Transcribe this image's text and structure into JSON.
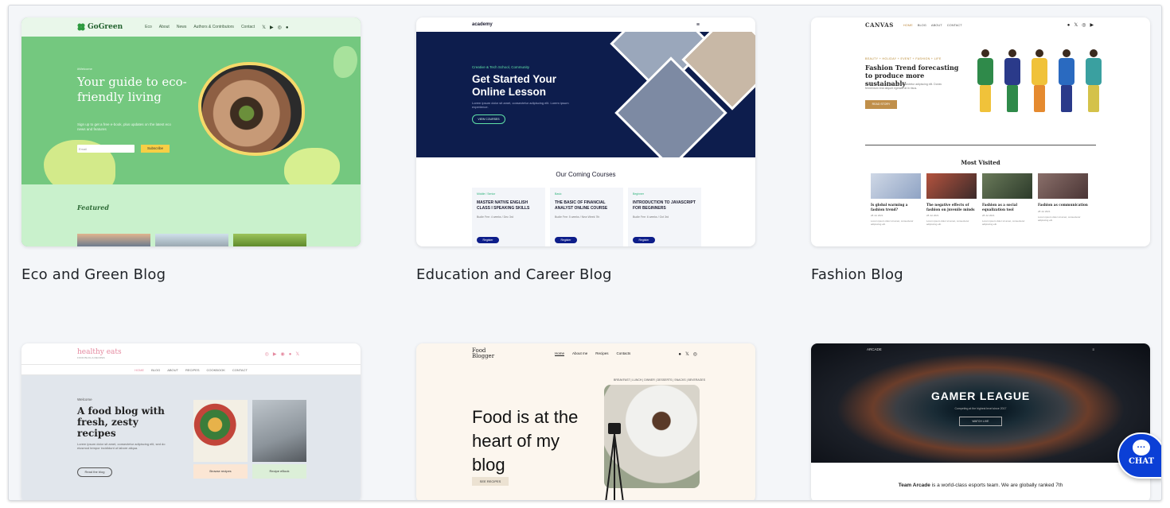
{
  "cards": {
    "eco": {
      "title": "Eco and Green Blog",
      "logo": "GoGreen",
      "nav": [
        "Eco",
        "About",
        "News",
        "Authors & Contributors",
        "Contact"
      ],
      "tag": "#Welcome",
      "headline": "Your guide to eco-friendly living",
      "subtext": "Sign up to get a free e-book, plus updates on the latest eco news and features",
      "email_placeholder": "Email",
      "subscribe_label": "Subscribe",
      "featured_label": "Featured"
    },
    "education": {
      "title": "Education and Career Blog",
      "logo": "academy",
      "tag": "Creative & Tech School, Community",
      "headline": "Get Started Your Online Lesson",
      "subtext": "Lorem ipsum dolor sit amet, consectetur adipiscing elit. Lorem ipsum experience.",
      "cta": "VIEW COURSES",
      "section_title": "Our Coming Courses",
      "courses": [
        {
          "level": "Middle / Senior",
          "name": "MASTER NATIVE ENGLISH CLASS I SPEAKING SKILLS",
          "meta": "Budle Fee: 4 weeks / Dec 3rd",
          "button": "Register"
        },
        {
          "level": "Basic",
          "name": "THE BASIC OF FINANCIAL ANALYST ONLINE COURSE",
          "meta": "Budle Fee: 5 weeks / New Week 7th",
          "button": "Register"
        },
        {
          "level": "Beginner",
          "name": "INTRODUCTION TO JAVASCRIPT FOR BEGINNERS",
          "meta": "Budle Fee: 6 weeks / Oct 3rd",
          "button": "Register"
        }
      ]
    },
    "fashion": {
      "title": "Fashion Blog",
      "logo": "CANVAS",
      "nav": [
        "HOME",
        "BLOG",
        "ABOUT",
        "CONTACT"
      ],
      "tag": "BEAUTY + HOLIDAY + EVENT + FASHION + LIFE",
      "headline": "Fashion Trend forecasting to produce more sustainably",
      "subtext": "Lorem ipsum dolor sit amet, consectetur adipiscing elit. Donec fermentum erat aliquet egestas at in risus.",
      "cta": "READ STORY",
      "most_visited": "Most Visited",
      "posts": [
        {
          "title": "Is global warming a fashion trend?",
          "date": "28 Jul 2021"
        },
        {
          "title": "The negative effects of fashion on juvenile minds",
          "date": "28 Jul 2021"
        },
        {
          "title": "Fashion as a social equalization tool",
          "date": "28 Jul 2021"
        },
        {
          "title": "Fashion as communication",
          "date": "28 Jul 2021"
        }
      ],
      "post_excerpt": "Lorem ipsum dolor sit amet, consectetur adipiscing elit."
    },
    "healthy": {
      "logo": "healthy eats",
      "logo_tagline": "FOOD BLOG & RECIPES",
      "menu": [
        "HOME",
        "BLOG",
        "ABOUT",
        "RECIPES",
        "COOKBOOK",
        "CONTACT"
      ],
      "tag": "Welcome",
      "headline": "A food blog with fresh, zesty recipes",
      "subtext": "Lorem ipsum dolor sit amet, consectetur adipiscing elit, sed do eiusmod tempor incididunt ut labore aliqua.",
      "cta": "Read the blog",
      "cta_browse": "Browse recipes",
      "cta_about": "Recipe eBook"
    },
    "food": {
      "logo": "Food Blogger",
      "nav": [
        "Home",
        "About me",
        "Recipes",
        "Contacts"
      ],
      "categories": "BREAKFAST | LUNCH | DINNER | DESSERTS | SNACKS | BEVERAGES",
      "headline": "Food is at the heart of my blog",
      "cta": "SEE RECIPES"
    },
    "arcade": {
      "logo": "ARCADE",
      "headline": "GAMER LEAGUE",
      "subtext": "Competing at the highest level since 2017",
      "cta": "WATCH LIVE",
      "desc_bold": "Team Arcade",
      "desc_rest": " is a world-class esports team. We are globally ranked 7th"
    }
  },
  "chat": {
    "label": "CHAT",
    "icon": "chat-bubble-icon"
  },
  "colors": {
    "accent": "#0b3fd6",
    "page_bg": "#f4f6f9"
  }
}
